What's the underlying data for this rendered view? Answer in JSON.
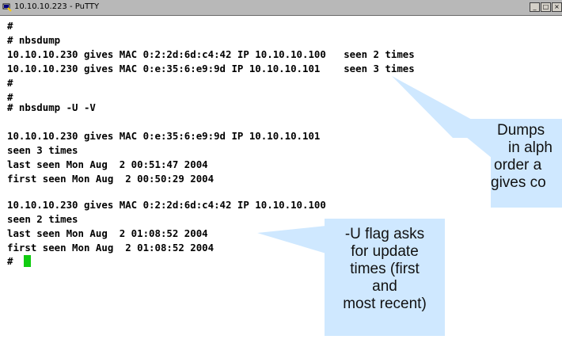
{
  "window": {
    "title": "10.10.10.223 - PuTTY",
    "app_icon": "putty-icon",
    "controls": [
      "minimize-icon",
      "maximize-icon",
      "close-icon"
    ]
  },
  "terminal": {
    "lines": [
      "#",
      "# nbsdump",
      "10.10.10.230 gives MAC 0:2:2d:6d:c4:42 IP 10.10.10.100   seen 2 times",
      "10.10.10.230 gives MAC 0:e:35:6:e9:9d IP 10.10.10.101    seen 3 times",
      "#",
      "#",
      "# nbsdump -U -V",
      "",
      "10.10.10.230 gives MAC 0:e:35:6:e9:9d IP 10.10.10.101",
      "seen 3 times",
      "last seen Mon Aug  2 00:51:47 2004",
      "first seen Mon Aug  2 00:50:29 2004",
      "",
      "10.10.10.230 gives MAC 0:2:2d:6d:c4:42 IP 10.10.10.100",
      "seen 2 times",
      "last seen Mon Aug  2 01:08:52 2004",
      "first seen Mon Aug  2 01:08:52 2004",
      "# "
    ],
    "cursor_color": "#11cc11"
  },
  "callouts": {
    "dumps": {
      "lines": [
        "Dumps",
        "in alph",
        "order a",
        "gives co"
      ]
    },
    "update": {
      "lines": [
        "-U flag asks",
        "for update",
        "times (first",
        "and",
        "most recent)"
      ]
    }
  }
}
